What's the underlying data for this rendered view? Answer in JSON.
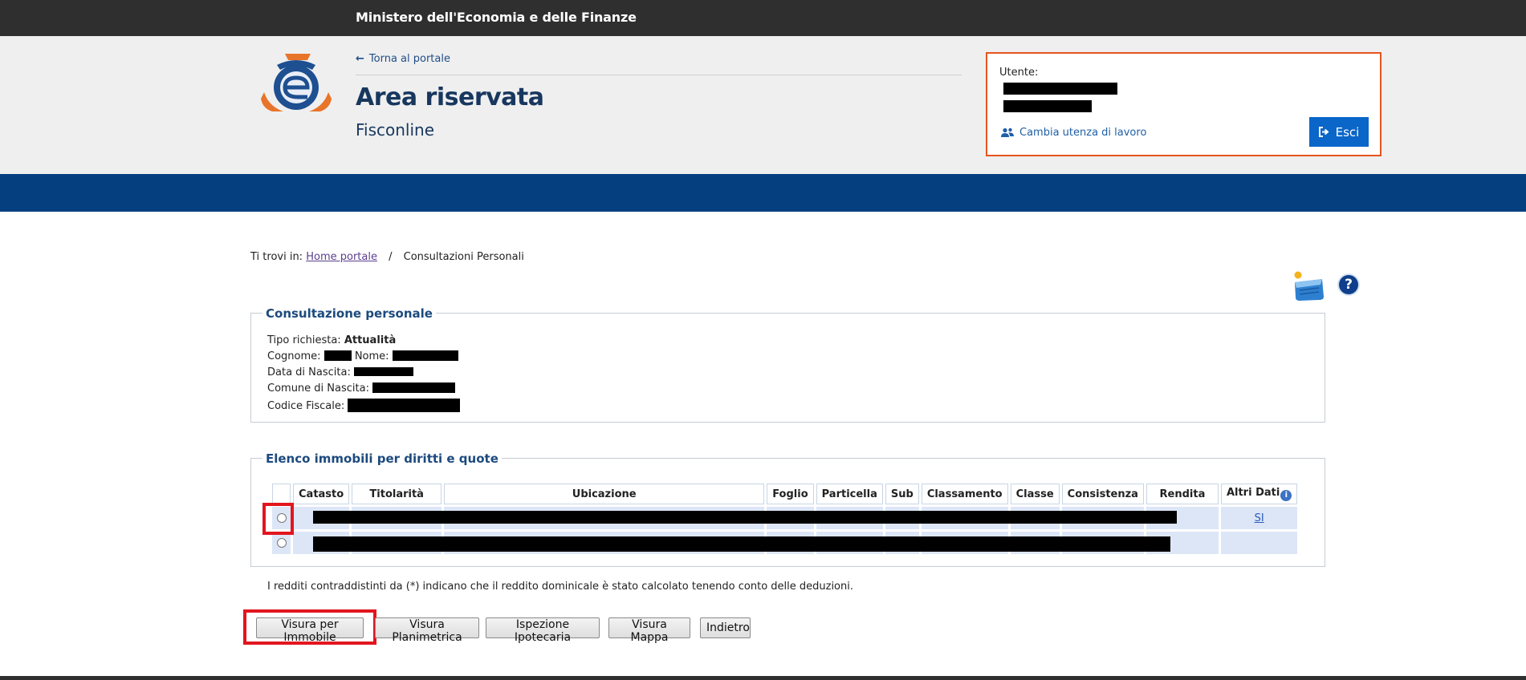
{
  "topbar": {
    "ministry": "Ministero dell'Economia e delle Finanze"
  },
  "header": {
    "back_link": "Torna al portale",
    "title": "Area riservata",
    "subtitle": "Fisconline",
    "user_label": "Utente:",
    "change_user": "Cambia utenza di lavoro",
    "logout": "Esci"
  },
  "breadcrumb": {
    "prefix": "Ti trovi in:",
    "home": "Home portale",
    "separator": "/",
    "current": "Consultazioni Personali"
  },
  "consultazione": {
    "legend": "Consultazione personale",
    "tipo_label": "Tipo richiesta:",
    "tipo_value": "Attualità",
    "cognome_label": "Cognome:",
    "nome_label": "Nome:",
    "data_label": "Data di Nascita:",
    "comune_label": "Comune di Nascita:",
    "cf_label": "Codice Fiscale:"
  },
  "elenco": {
    "legend": "Elenco immobili per diritti e quote",
    "columns": [
      "Catasto",
      "Titolarità",
      "Ubicazione",
      "Foglio",
      "Particella",
      "Sub",
      "Classamento",
      "Classe",
      "Consistenza",
      "Rendita",
      "Altri Dati"
    ],
    "row1_altri": "SI"
  },
  "note": "I redditi contraddistinti da (*) indicano che il reddito dominicale è stato calcolato tenendo conto delle deduzioni.",
  "buttons": {
    "visura_immobile": "Visura per Immobile",
    "visura_planimetrica": "Visura Planimetrica",
    "ispezione": "Ispezione Ipotecaria",
    "visura_mappa": "Visura Mappa",
    "indietro": "Indietro"
  },
  "colors": {
    "topbar": "#2f2f2f",
    "blueband": "#063f80",
    "title": "#17375e",
    "user_box_border": "#e6541d",
    "logout_button": "#0a66c8",
    "highlight": "#e2161f"
  },
  "icons": [
    "arrow-left-icon",
    "users-icon",
    "logout-icon",
    "cart-icon",
    "help-icon",
    "info-icon",
    "agency-logo"
  ]
}
